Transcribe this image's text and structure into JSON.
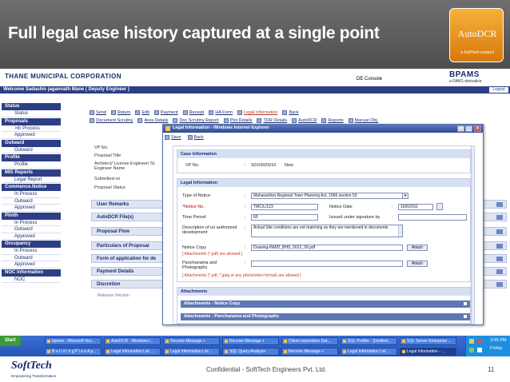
{
  "slide": {
    "title": "Full legal case history captured at a single point",
    "logo_text": "AutoDCR",
    "logo_sub": "a SoftTech product",
    "footer": "Confidential - SoftTech Engineers Pvt. Ltd.",
    "page_number": "11",
    "company_logo": "SoftTech",
    "company_tagline": "Empowering Transformation"
  },
  "app": {
    "corp_title": "THANE MUNICIPAL CORPORATION",
    "console": "DE Console",
    "brand": "BPAMS",
    "brand_sub": "a FAMS derivative",
    "welcome": "Welcome Sadashiv jagannath Mane ( Deputy Engineer )",
    "logout": "Logout"
  },
  "sidebar": [
    {
      "head": "Status",
      "items": [
        "Status"
      ]
    },
    {
      "head": "Proposals",
      "items": [
        ">In Process",
        "Approved"
      ]
    },
    {
      "head": "Outward",
      "items": [
        "Outward"
      ]
    },
    {
      "head": "Profile",
      "items": [
        "Profile"
      ]
    },
    {
      "head": "MIS Reports",
      "items": [
        "Legal Report"
      ]
    },
    {
      "head": "Commence.Notice",
      "items": [
        "In Process",
        "Outward",
        "Approved"
      ]
    },
    {
      "head": "Plinth",
      "items": [
        "In Process",
        "Outward",
        "Approved"
      ]
    },
    {
      "head": "Occupancy",
      "items": [
        "In Process",
        "Outward",
        "Approved"
      ]
    },
    {
      "head": "NOC Information",
      "items": [
        "NOC"
      ]
    }
  ],
  "toolbar": {
    "row1": [
      "Send",
      "Return",
      "Edit",
      "Payment",
      "Receipt",
      "HA Form",
      "Legal Information",
      "Back"
    ],
    "row2": [
      "Document Scrutiny",
      "Area Details",
      "Doc Scrutiny Report",
      "Plot Details",
      "TDR Details",
      "AutoDCR",
      "Reports",
      "Manual Obj."
    ]
  },
  "background_labels": [
    "VP No.",
    "Proposal Title",
    "Architect/ License Engineer/ St. Engineer Name",
    "Submitted on",
    "Proposal Status"
  ],
  "background_sections": [
    "User Remarks",
    "AutoDCR File(s)",
    "Proposal Flow",
    "Particulars of Proposal",
    "Form of application for de",
    "Payment Details",
    "Discretion"
  ],
  "release_version": "Release Version",
  "popup": {
    "title": "Legal Information - Windows Internet Explorer",
    "save": "Save",
    "back": "Back",
    "case_info": {
      "header": "Case Information",
      "vp_label": "VP No.",
      "vp_value": "S01/0020/10",
      "status": "New"
    },
    "legal_info": {
      "header": "Legal Information",
      "type_label": "Type of Notice",
      "type_value": "Maharashtra Regional Town Planning Act, 1966 section 53",
      "notice_no_label": "*Notice No.",
      "notice_no_value": "TMC/L/123",
      "notice_date_label": "Notice Date",
      "notice_date_value": "10/6/2011",
      "time_label": "Time Period",
      "time_value": "60",
      "issued_label": "Issued under signature by",
      "issued_value": "",
      "desc_label": "Description of un authorized development",
      "desc_value": "Actual Site conditions are not matching as they are mentioned in documents",
      "notice_copy_label": "Notice Copy",
      "notice_copy_value": "Drawing-INWD_BHS_0012_09.pdf",
      "notice_copy_note": "[ Attachments (*.pdf) are allowed ]",
      "panch_label": "Panchanama and Photographs",
      "panch_value": "",
      "panch_note": "[ Attachments (*.pdf, *.jpeg or any photo/video format) are allowed ]",
      "attach_btn": "Attach"
    },
    "attachments": {
      "header": "Attachments",
      "items": [
        "Attachments - Notice Copy",
        "Attachments - Panchanama and Photographs"
      ]
    }
  },
  "taskbar": {
    "start": "Start",
    "row1": [
      "bpams - Microsoft Vou...",
      "AutoDCR - Windows I...",
      "Receive Message +",
      "Receive Message +",
      "Client corporation Dat...",
      "SQL Profiler - [Untitled...",
      "SQL Server Enterprise ..."
    ],
    "row2": [
      "B u i l d i n g P l a n A p...",
      "Legal Information List ...",
      "Legal Information List ...",
      "SQL Query Analyzer",
      "Receive Message +",
      "Legal Information List ...",
      "Legal Information - ..."
    ],
    "time": "3:45 PM",
    "day": "Friday"
  },
  "colors": {
    "navy": "#2c3f86",
    "header_gray": "#5e5e5e",
    "taskbar_blue": "#2456b8",
    "accent_orange": "#e8911f"
  }
}
